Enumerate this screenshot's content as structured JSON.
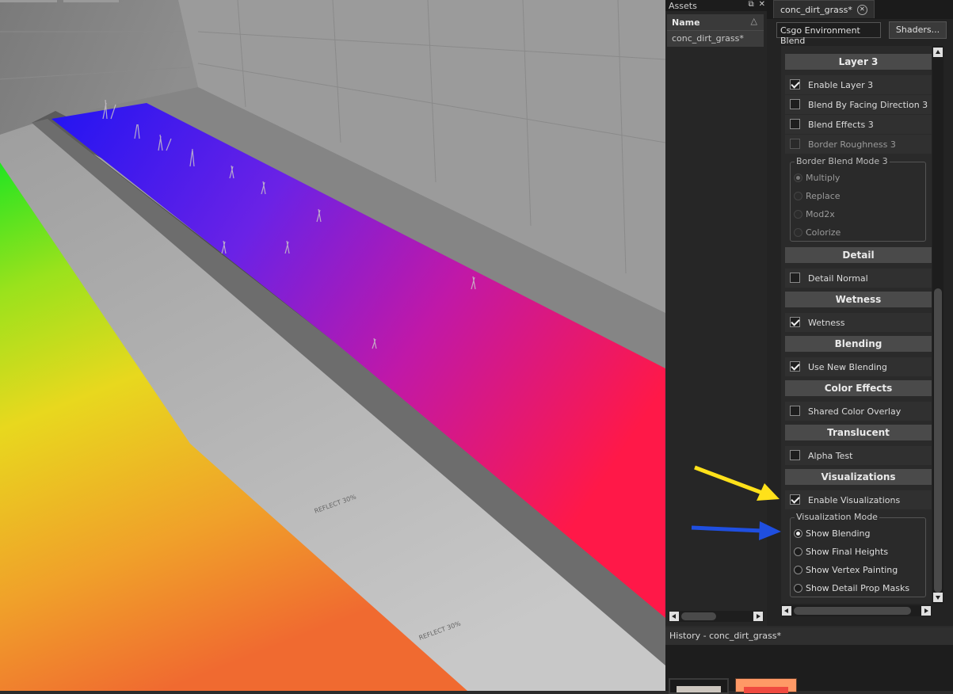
{
  "viewport": {
    "description_colors": {
      "green": "#22dd22",
      "yellow": "#f2d21a",
      "blue": "#2a10f0",
      "magenta": "#ff1a6a"
    },
    "wall_labels": [
      "REFLECT 30%",
      "REFLECT 30%"
    ]
  },
  "assets": {
    "title": "Assets",
    "column_name": "Name",
    "items": [
      "conc_dirt_grass*"
    ]
  },
  "editor": {
    "tab_label": "conc_dirt_grass*",
    "shader_value": "Csgo Environment Blend",
    "shaders_button": "Shaders...",
    "sections": {
      "layer3": "Layer 3",
      "detail": "Detail",
      "wetness": "Wetness",
      "blending": "Blending",
      "color_effects": "Color Effects",
      "translucent": "Translucent",
      "visualizations": "Visualizations"
    },
    "options": {
      "enable_layer3": "Enable Layer 3",
      "blend_facing": "Blend By Facing Direction 3",
      "blend_effects": "Blend Effects 3",
      "border_roughness": "Border Roughness 3",
      "detail_normal": "Detail Normal",
      "wetness": "Wetness",
      "use_new_blending": "Use New Blending",
      "shared_color_overlay": "Shared Color Overlay",
      "alpha_test": "Alpha Test",
      "enable_visualizations": "Enable Visualizations"
    },
    "border_blend_mode": {
      "title": "Border Blend Mode 3",
      "options": [
        "Multiply",
        "Replace",
        "Mod2x",
        "Colorize"
      ]
    },
    "visualization_mode": {
      "title": "Visualization Mode",
      "options": [
        "Show Blending",
        "Show Final Heights",
        "Show Vertex Painting",
        "Show Detail Prop Masks"
      ]
    }
  },
  "history": {
    "title": "History - conc_dirt_grass*"
  },
  "annotation_colors": {
    "yellow_arrow": "#ffe11a",
    "blue_arrow": "#1f4fe0"
  }
}
